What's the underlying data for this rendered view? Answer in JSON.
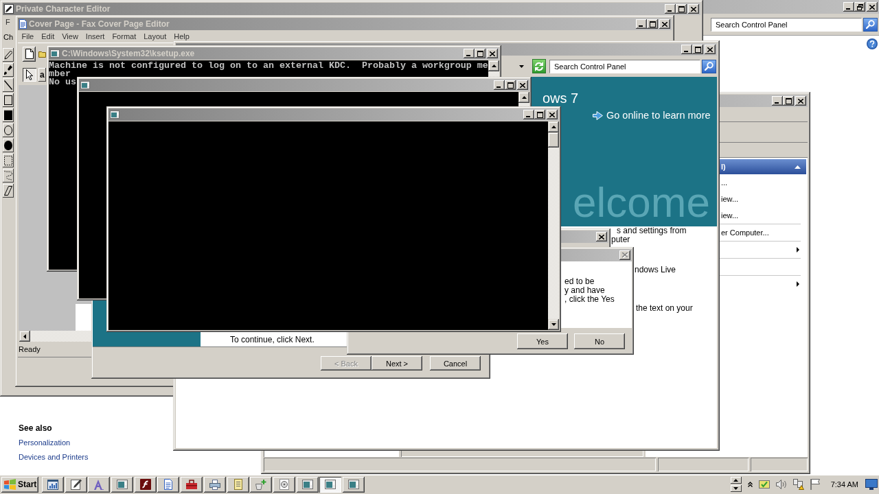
{
  "control_panel": {
    "search": {
      "placeholder": "Search Control Panel"
    },
    "see_also": {
      "heading": "See also",
      "links": [
        "Personalization",
        "Devices and Printers"
      ]
    }
  },
  "character_editor": {
    "title": "Private Character Editor",
    "menu": [
      "F"
    ],
    "toolbar_label": "Ch"
  },
  "cover_page_editor": {
    "title": "Cover Page - Fax Cover Page Editor",
    "menu": [
      "File",
      "Edit",
      "View",
      "Insert",
      "Format",
      "Layout",
      "Help"
    ],
    "drawing_tools": [
      {
        "kind": "pointer",
        "selected": true
      },
      {
        "kind": "text",
        "label": "a",
        "selected": false
      }
    ],
    "status": "Ready"
  },
  "management_console": {
    "group_header": "l)",
    "actions": [
      {
        "kind": "action",
        "label": "..."
      },
      {
        "kind": "action",
        "label": "iew..."
      },
      {
        "kind": "action",
        "label": "iew..."
      },
      {
        "kind": "action",
        "label": "er Computer..."
      },
      {
        "kind": "submenu"
      },
      {
        "kind": "blank"
      },
      {
        "kind": "submenu"
      }
    ]
  },
  "getting_started": {
    "search": {
      "placeholder": "Search Control Panel"
    },
    "banner_title": "ows 7",
    "learn_more_link": "Go online to learn more",
    "banner_heading": "elcome",
    "texts": [
      "s and settings from",
      "puter",
      "ndows Live",
      "the text on your"
    ]
  },
  "setup_wizard": {
    "message": "To continue, click Next.",
    "buttons": [
      {
        "label": "< Back",
        "disabled": true
      },
      {
        "label": "Next >",
        "disabled": false
      },
      {
        "label": "Cancel",
        "disabled": false
      }
    ]
  },
  "back_dialog": {
    "close_button": {
      "disabled": false
    }
  },
  "confirm_dialog": {
    "close_button": {
      "disabled": true
    },
    "texts": [
      "ed to be",
      "y and have",
      ", click the Yes"
    ],
    "buttons": [
      {
        "label": "Yes"
      },
      {
        "label": "No"
      }
    ]
  },
  "consoles": [
    {
      "kind": "output",
      "title": "C:\\Windows\\System32\\ksetup.exe",
      "lines": [
        "Machine is not configured to log on to an external KDC.  Probably a workgroup me",
        "mber",
        "No us"
      ]
    },
    {
      "kind": "blank"
    },
    {
      "kind": "blank"
    }
  ],
  "taskbar": {
    "start": "Start",
    "tasks": [
      {
        "kind": "chart_window",
        "selected": false
      },
      {
        "kind": "pencil",
        "selected": false
      },
      {
        "kind": "font",
        "selected": false
      },
      {
        "kind": "console",
        "selected": false
      },
      {
        "kind": "script_tile",
        "selected": false
      },
      {
        "kind": "document",
        "selected": false
      },
      {
        "kind": "toolbox",
        "selected": false
      },
      {
        "kind": "printer",
        "selected": false
      },
      {
        "kind": "notepad",
        "selected": false
      },
      {
        "kind": "plus",
        "selected": false
      },
      {
        "kind": "disc",
        "selected": false
      },
      {
        "kind": "console",
        "selected": false
      },
      {
        "kind": "console",
        "selected": true
      },
      {
        "kind": "console",
        "selected": false
      }
    ],
    "clock": "7:34 AM"
  }
}
